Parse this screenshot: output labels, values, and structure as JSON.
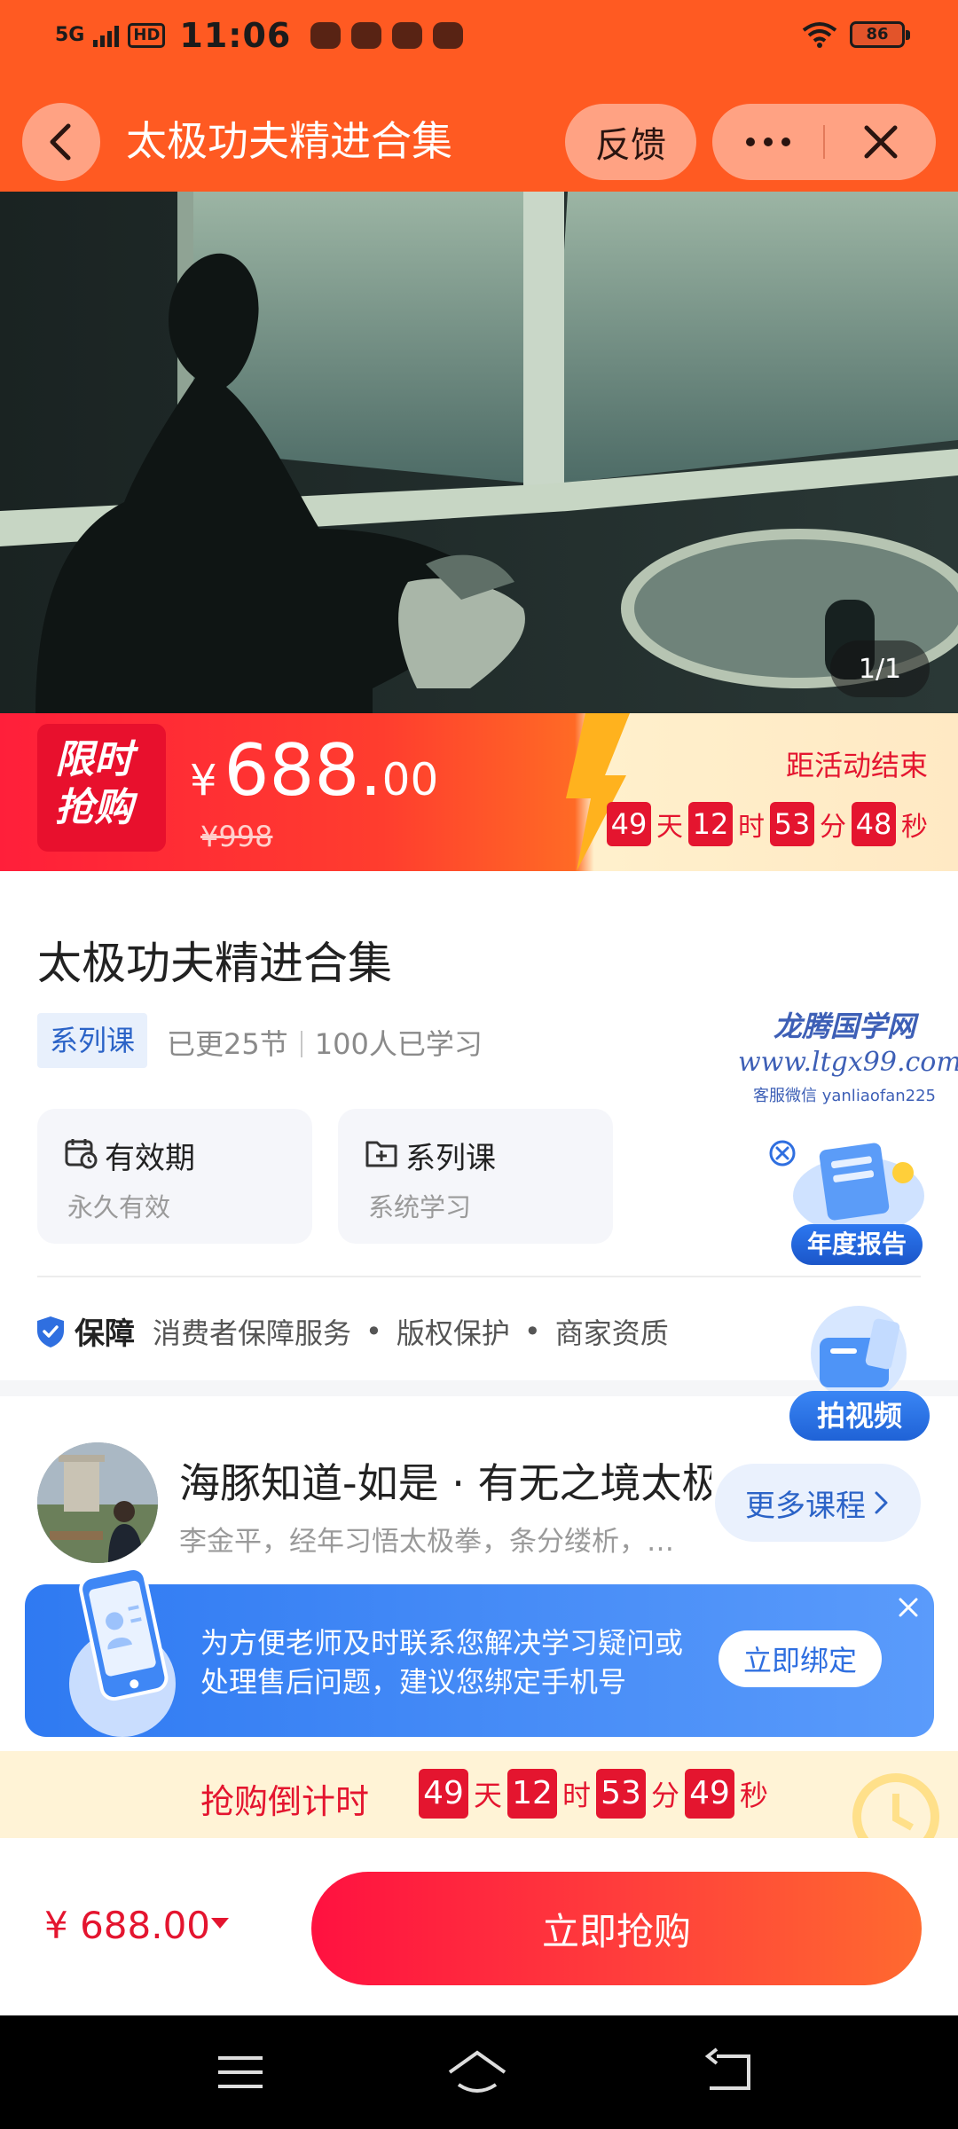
{
  "status_bar": {
    "network": "5G",
    "hd": "HD",
    "time": "11:06",
    "battery": "86"
  },
  "header": {
    "title": "太极功夫精进合集",
    "feedback_label": "反馈",
    "back_icon": "chevron-left-icon",
    "more_icon": "more-dots-icon",
    "close_icon": "close-icon"
  },
  "media": {
    "pager": "1/1"
  },
  "flash_sale": {
    "badge_line1": "限时",
    "badge_line2": "抢购",
    "currency": "¥",
    "price_int": "688.",
    "price_dec": "00",
    "original_price": "¥998",
    "end_label": "距活动结束",
    "countdown": {
      "days": "49",
      "day_unit": "天",
      "hours": "12",
      "hour_unit": "时",
      "minutes": "53",
      "minute_unit": "分",
      "seconds": "48",
      "second_unit": "秒"
    }
  },
  "course": {
    "title": "太极功夫精进合集",
    "tag": "系列课",
    "updated": "已更25节",
    "learners": "100人已学习",
    "cards": [
      {
        "title": "有效期",
        "subtitle": "永久有效",
        "icon": "calendar-clock-icon"
      },
      {
        "title": "系列课",
        "subtitle": "系统学习",
        "icon": "folder-plus-icon"
      }
    ]
  },
  "guarantee": {
    "label": "保障",
    "items": [
      "消费者保障服务",
      "版权保护",
      "商家资质"
    ],
    "separator": "•"
  },
  "teacher": {
    "name": "海豚知道-如是 · 有无之境太极",
    "description": "李金平，经年习悟太极拳，条分缕析，…",
    "more_label": "更多课程"
  },
  "bind_banner": {
    "line1": "为方便老师及时联系您解决学习疑问或",
    "line2": "处理售后问题，建议您绑定手机号",
    "button": "立即绑定"
  },
  "countdown_bar": {
    "label": "抢购倒计时",
    "days": "49",
    "day_unit": "天",
    "hours": "12",
    "hour_unit": "时",
    "minutes": "53",
    "minute_unit": "分",
    "seconds": "49",
    "second_unit": "秒"
  },
  "purchase": {
    "price": "¥ 688.00",
    "button": "立即抢购"
  },
  "watermark": {
    "line1": "龙腾国学网",
    "line2": "www.ltgx99.com",
    "line3": "客服微信 yanliaofan225"
  },
  "floating": {
    "report_label": "年度报告",
    "video_label": "拍视频"
  },
  "colors": {
    "brand_orange": "#ff5a22",
    "sale_red": "#e4152f",
    "link_blue": "#2b63c7"
  }
}
